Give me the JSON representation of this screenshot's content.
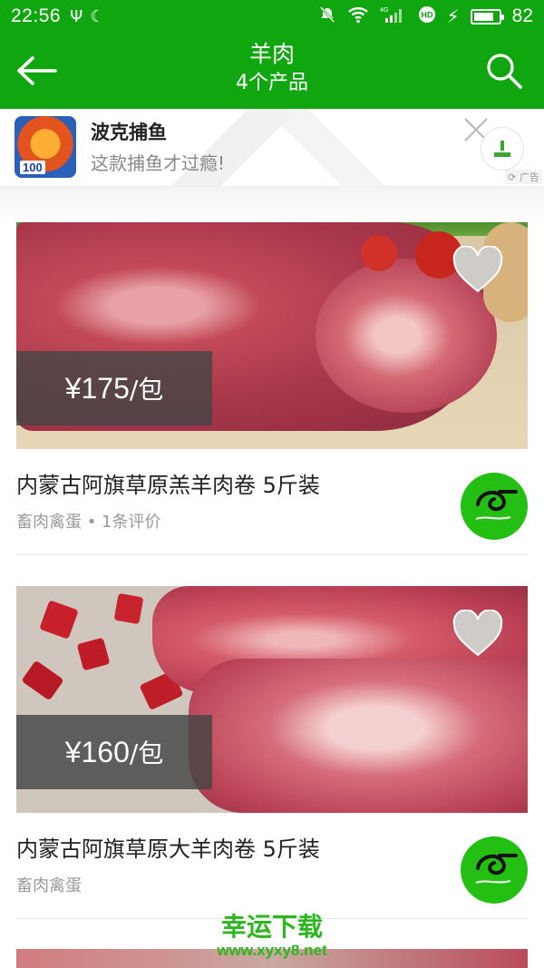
{
  "status_bar": {
    "time": "22:56",
    "battery_percent": "82",
    "battery_level": 0.82,
    "network": "4G"
  },
  "app_bar": {
    "title": "羊肉",
    "subtitle": "4个产品",
    "back_icon": "arrow-left-icon",
    "search_icon": "search-icon"
  },
  "ad": {
    "title": "波克捕鱼",
    "description": "这款捕鱼才过瘾!",
    "badge": "100",
    "tag": "广告"
  },
  "products": [
    {
      "price": "¥175",
      "unit": "/包",
      "title": "内蒙古阿旗草原羔羊肉卷 5斤装",
      "meta": "畜肉禽蛋 • 1条评价"
    },
    {
      "price": "¥160",
      "unit": "/包",
      "title": "内蒙古阿旗草原大羊肉卷 5斤装",
      "meta": "畜肉禽蛋"
    }
  ],
  "watermark": {
    "title": "幸运下载",
    "url": "www.xyxy8.net"
  },
  "colors": {
    "brand_green": "#10a60f",
    "shop_logo_green": "#23bf12"
  }
}
